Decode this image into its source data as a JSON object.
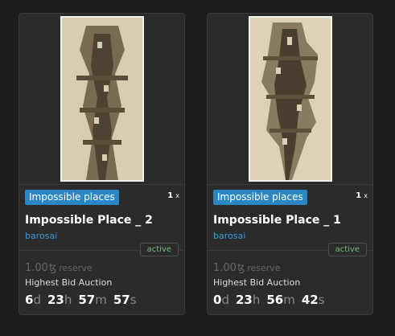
{
  "cards": [
    {
      "collection": "Impossible places",
      "edition_count": "1",
      "edition_suffix": "x",
      "title": "Impossible Place _ 2",
      "artist": "barosai",
      "status": "active",
      "reserve_amount": "1.00",
      "currency_symbol": "ꜩ",
      "reserve_label": "reserve",
      "auction_type": "Highest Bid Auction",
      "countdown": {
        "d": "6",
        "h": "23",
        "m": "57",
        "s": "57"
      },
      "countdown_units": {
        "d": "d",
        "h": "h",
        "m": "m",
        "s": "s"
      }
    },
    {
      "collection": "Impossible places",
      "edition_count": "1",
      "edition_suffix": "x",
      "title": "Impossible Place _ 1",
      "artist": "barosai",
      "status": "active",
      "reserve_amount": "1.00",
      "currency_symbol": "ꜩ",
      "reserve_label": "reserve",
      "auction_type": "Highest Bid Auction",
      "countdown": {
        "d": "0",
        "h": "23",
        "m": "56",
        "s": "42"
      },
      "countdown_units": {
        "d": "d",
        "h": "h",
        "m": "m",
        "s": "s"
      }
    }
  ],
  "colors": {
    "background": "#1c1c1c",
    "card": "#2b2b2b",
    "collection_badge": "#2a87c4",
    "artist_link": "#3d9bd8",
    "status_active": "#6fbf7e"
  }
}
